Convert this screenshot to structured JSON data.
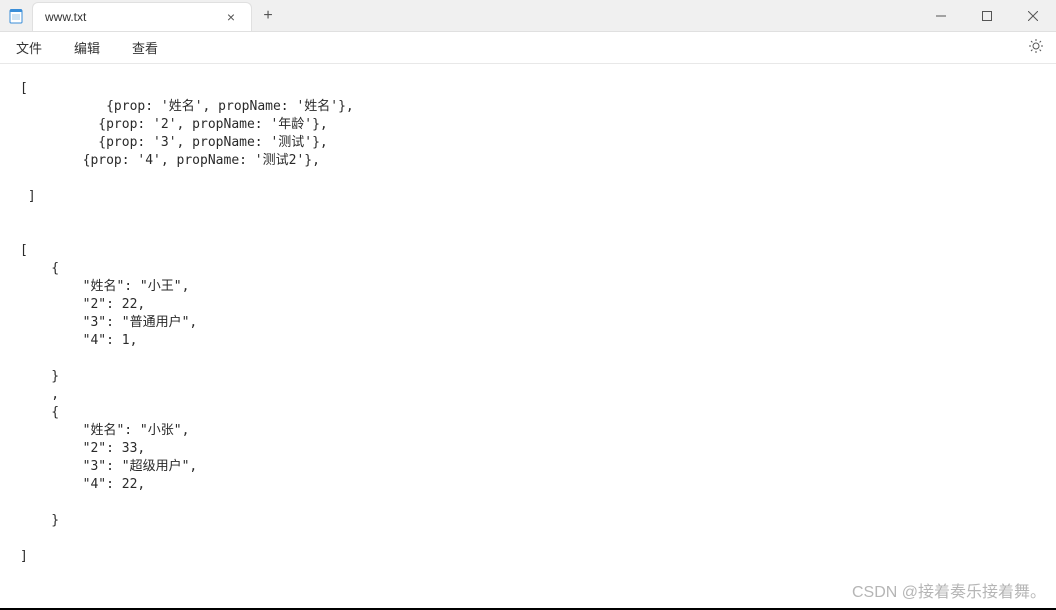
{
  "titlebar": {
    "filename": "www.txt",
    "close_glyph": "×",
    "new_tab_glyph": "+"
  },
  "menubar": {
    "file": "文件",
    "edit": "编辑",
    "view": "查看"
  },
  "editor": {
    "content": "[\n           {prop: '姓名', propName: '姓名'},\n          {prop: '2', propName: '年龄'},\n          {prop: '3', propName: '测试'},\n        {prop: '4', propName: '测试2'},\n\n ]\n\n\n[\n    {\n        \"姓名\": \"小王\",\n        \"2\": 22,\n        \"3\": \"普通用户\",\n        \"4\": 1,\n\n    }\n    ,\n    {\n        \"姓名\": \"小张\",\n        \"2\": 33,\n        \"3\": \"超级用户\",\n        \"4\": 22,\n\n    }\n\n]"
  },
  "watermark": "CSDN @接着奏乐接着舞。"
}
